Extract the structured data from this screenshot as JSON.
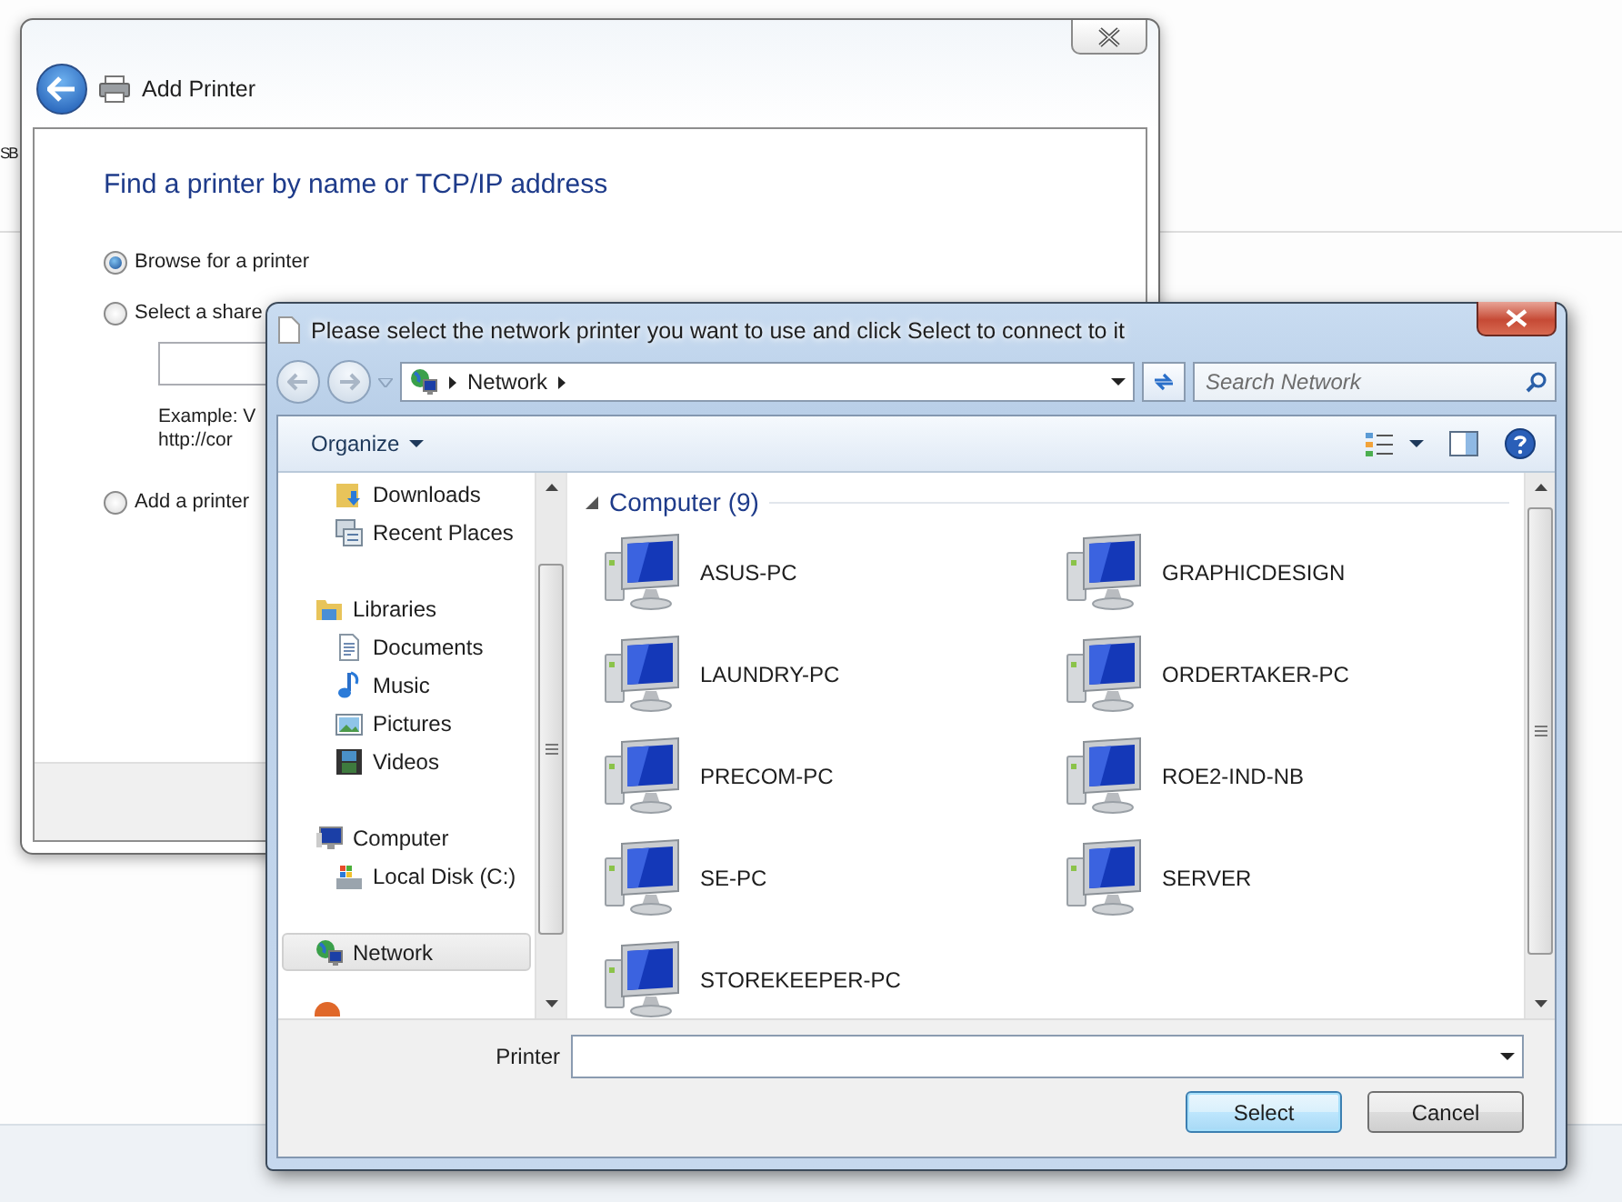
{
  "desktop": {
    "label": "SB"
  },
  "add_printer": {
    "title": "Add Printer",
    "heading": "Find a printer by name or TCP/IP address",
    "options": [
      {
        "label": "Browse for a printer",
        "selected": true
      },
      {
        "label": "Select a share",
        "selected": false,
        "field": {
          "example_lines": [
            "Example: V",
            "http://cor"
          ]
        }
      },
      {
        "label": "Add a printer",
        "selected": false
      }
    ]
  },
  "dialog": {
    "title": "Please select the network printer you want to use and click Select to connect to it",
    "address": {
      "path": [
        "Network"
      ]
    },
    "search": {
      "placeholder": "Search Network"
    },
    "toolbar": {
      "organize": "Organize"
    },
    "nav": [
      {
        "children": [
          {
            "label": "Downloads",
            "kind": "downloads",
            "selected": false
          },
          {
            "label": "Recent Places",
            "kind": "recent",
            "selected": false
          }
        ]
      },
      {
        "label": "Libraries",
        "kind": "library",
        "selected": false,
        "children": [
          {
            "label": "Documents",
            "kind": "documents",
            "selected": false
          },
          {
            "label": "Music",
            "kind": "music",
            "selected": false
          },
          {
            "label": "Pictures",
            "kind": "pictures",
            "selected": false
          },
          {
            "label": "Videos",
            "kind": "videos",
            "selected": false
          }
        ]
      },
      {
        "label": "Computer",
        "kind": "computer",
        "selected": false,
        "children": [
          {
            "label": "Local Disk (C:)",
            "kind": "disk",
            "selected": false
          }
        ]
      },
      {
        "label": "Network",
        "kind": "network",
        "selected": true
      }
    ],
    "group": {
      "label": "Computer (9)",
      "expanded": true
    },
    "items": [
      {
        "label": "ASUS-PC"
      },
      {
        "label": "GRAPHICDESIGN"
      },
      {
        "label": "LAUNDRY-PC"
      },
      {
        "label": "ORDERTAKER-PC"
      },
      {
        "label": "PRECOM-PC"
      },
      {
        "label": "ROE2-IND-NB"
      },
      {
        "label": "SE-PC"
      },
      {
        "label": "SERVER"
      },
      {
        "label": "STOREKEEPER-PC"
      }
    ],
    "printer_label": "Printer",
    "buttons": [
      {
        "label": "Select",
        "kind": "default"
      },
      {
        "label": "Cancel",
        "kind": "normal"
      }
    ]
  }
}
